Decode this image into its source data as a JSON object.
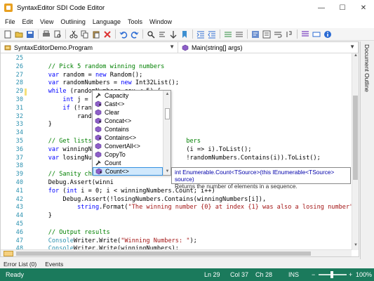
{
  "window": {
    "title": "SyntaxEditor SDI Code Editor",
    "minimize": "—",
    "maximize": "☐",
    "close": "✕"
  },
  "menu": [
    "File",
    "Edit",
    "View",
    "Outlining",
    "Language",
    "Tools",
    "Window"
  ],
  "toolbar_icons": [
    "new-icon",
    "open-icon",
    "save-icon",
    "separator",
    "print-icon",
    "print-preview-icon",
    "separator",
    "cut-icon",
    "copy-icon",
    "paste-icon",
    "delete-icon",
    "separator",
    "undo-icon",
    "redo-icon",
    "separator",
    "find-icon",
    "find-replace-icon",
    "goto-icon",
    "bookmark-icon",
    "separator",
    "indent-icon",
    "outdent-icon",
    "separator",
    "comment-icon",
    "uncomment-icon",
    "separator",
    "format-icon",
    "outline-icon",
    "wrap-icon",
    "whitespace-icon",
    "separator",
    "list-members-icon",
    "parameter-info-icon",
    "quick-info-icon"
  ],
  "nav": {
    "type_combo": "SyntaxEditorDemo.Program",
    "member_combo": "Main(string[] args)"
  },
  "side_panel": {
    "tab": "Document Outline"
  },
  "code_lines": [
    {
      "n": "25",
      "marker": "none",
      "segs": []
    },
    {
      "n": "26",
      "marker": "none",
      "segs": [
        {
          "t": "    // Pick 5 random winning numbers",
          "c": "cm"
        }
      ]
    },
    {
      "n": "27",
      "marker": "none",
      "segs": [
        {
          "t": "    ",
          "c": ""
        },
        {
          "t": "var",
          "c": "kw"
        },
        {
          "t": " random = ",
          "c": ""
        },
        {
          "t": "new",
          "c": "kw"
        },
        {
          "t": " Random();",
          "c": ""
        }
      ]
    },
    {
      "n": "28",
      "marker": "none",
      "segs": [
        {
          "t": "    ",
          "c": ""
        },
        {
          "t": "var",
          "c": "kw"
        },
        {
          "t": " randomNumbers = ",
          "c": ""
        },
        {
          "t": "new",
          "c": "kw"
        },
        {
          "t": " Int32List();",
          "c": ""
        }
      ]
    },
    {
      "n": "29",
      "marker": "mod",
      "segs": [
        {
          "t": "    ",
          "c": ""
        },
        {
          "t": "while",
          "c": "kw"
        },
        {
          "t": " (randomNumbers.cou < 5) {",
          "c": ""
        }
      ]
    },
    {
      "n": "30",
      "marker": "none",
      "segs": [
        {
          "t": "        ",
          "c": ""
        },
        {
          "t": "int",
          "c": "kw"
        },
        {
          "t": " j = random",
          "c": ""
        }
      ]
    },
    {
      "n": "31",
      "marker": "none",
      "segs": [
        {
          "t": "        ",
          "c": ""
        },
        {
          "t": "if",
          "c": "kw"
        },
        {
          "t": " (!randomNum",
          "c": ""
        }
      ]
    },
    {
      "n": "32",
      "marker": "none",
      "segs": [
        {
          "t": "            randomNumb",
          "c": ""
        }
      ]
    },
    {
      "n": "33",
      "marker": "none",
      "segs": [
        {
          "t": "    }",
          "c": ""
        }
      ]
    },
    {
      "n": "34",
      "marker": "none",
      "segs": []
    },
    {
      "n": "35",
      "marker": "none",
      "segs": [
        {
          "t": "    // Get lists of th",
          "c": "cm"
        },
        {
          "t": "                    ",
          "c": ""
        },
        {
          "t": "bers",
          "c": "cm"
        }
      ]
    },
    {
      "n": "36",
      "marker": "none",
      "segs": [
        {
          "t": "    ",
          "c": ""
        },
        {
          "t": "var",
          "c": "kw"
        },
        {
          "t": " winningNumbers",
          "c": ""
        },
        {
          "t": "                    ",
          "c": ""
        },
        {
          "t": "(i => i).ToList();",
          "c": ""
        }
      ]
    },
    {
      "n": "37",
      "marker": "none",
      "segs": [
        {
          "t": "    ",
          "c": ""
        },
        {
          "t": "var",
          "c": "kw"
        },
        {
          "t": " losingNumbers",
          "c": ""
        },
        {
          "t": "                     ",
          "c": ""
        },
        {
          "t": "!randomNumbers.Contains(i)).ToList();",
          "c": ""
        }
      ]
    },
    {
      "n": "38",
      "marker": "none",
      "segs": []
    },
    {
      "n": "39",
      "marker": "none",
      "segs": [
        {
          "t": "    // Sanity check",
          "c": "cm"
        }
      ]
    },
    {
      "n": "40",
      "marker": "none",
      "segs": [
        {
          "t": "    Debug.Assert(winni",
          "c": ""
        }
      ]
    },
    {
      "n": "41",
      "marker": "none",
      "segs": [
        {
          "t": "    ",
          "c": ""
        },
        {
          "t": "for",
          "c": "kw"
        },
        {
          "t": " (",
          "c": ""
        },
        {
          "t": "int",
          "c": "kw"
        },
        {
          "t": " i = 0; i < winningNumbers.Count; i++)",
          "c": ""
        }
      ]
    },
    {
      "n": "42",
      "marker": "none",
      "segs": [
        {
          "t": "        Debug.Assert(!losingNumbers.Contains(winningNumbers[i]),",
          "c": ""
        }
      ]
    },
    {
      "n": "43",
      "marker": "none",
      "segs": [
        {
          "t": "            ",
          "c": ""
        },
        {
          "t": "string",
          "c": "kw"
        },
        {
          "t": ".Format(",
          "c": ""
        },
        {
          "t": "\"The winning number {0} at index {1} was also a losing number\"",
          "c": "st"
        },
        {
          "t": ", winningNumb",
          "c": ""
        }
      ]
    },
    {
      "n": "44",
      "marker": "none",
      "segs": [
        {
          "t": "    }",
          "c": ""
        }
      ]
    },
    {
      "n": "45",
      "marker": "none",
      "segs": []
    },
    {
      "n": "46",
      "marker": "none",
      "segs": [
        {
          "t": "    // Output results",
          "c": "cm"
        }
      ]
    },
    {
      "n": "47",
      "marker": "none",
      "segs": [
        {
          "t": "    ",
          "c": ""
        },
        {
          "t": "Console",
          "c": "ty"
        },
        {
          "t": "Writer.Write(",
          "c": ""
        },
        {
          "t": "\"Winning Numbers: \"",
          "c": "st"
        },
        {
          "t": ");",
          "c": ""
        }
      ]
    },
    {
      "n": "48",
      "marker": "none",
      "segs": [
        {
          "t": "    ",
          "c": ""
        },
        {
          "t": "Console",
          "c": "ty"
        },
        {
          "t": "Writer.Write(winningNumbers);",
          "c": ""
        }
      ]
    },
    {
      "n": "49",
      "marker": "none",
      "segs": [
        {
          "t": "    ",
          "c": ""
        },
        {
          "t": "Console",
          "c": "ty"
        },
        {
          "t": "Writer.NewLine();",
          "c": ""
        }
      ]
    },
    {
      "n": "50",
      "marker": "none",
      "segs": []
    }
  ],
  "completion": {
    "items": [
      {
        "label": "Capacity",
        "icon": "property-icon"
      },
      {
        "label": "Cast<>",
        "icon": "extension-method-icon"
      },
      {
        "label": "Clear",
        "icon": "method-icon"
      },
      {
        "label": "Concat<>",
        "icon": "extension-method-icon"
      },
      {
        "label": "Contains",
        "icon": "method-icon"
      },
      {
        "label": "Contains<>",
        "icon": "extension-method-icon"
      },
      {
        "label": "ConvertAll<>",
        "icon": "method-icon"
      },
      {
        "label": "CopyTo",
        "icon": "method-icon"
      },
      {
        "label": "Count",
        "icon": "property-icon"
      },
      {
        "label": "Count<>",
        "icon": "extension-method-icon",
        "selected": true
      }
    ]
  },
  "tooltip": {
    "signature": "int Enumerable.Count<TSource>(this IEnumerable<TSource> source)",
    "description": "Returns the number of elements in a sequence."
  },
  "bottom_tabs": [
    "Error List (0)",
    "Events"
  ],
  "status": {
    "ready": "Ready",
    "line": "Ln 29",
    "col": "Col 37",
    "ch": "Ch 28",
    "mode": "INS",
    "zoom": "100%",
    "zoom_minus": "−",
    "zoom_plus": "+"
  },
  "colors": {
    "status_bar": "#1b7a5c",
    "selection": "#d0e8fc",
    "keyword": "#0000ff",
    "comment": "#008000",
    "string": "#a31515"
  }
}
